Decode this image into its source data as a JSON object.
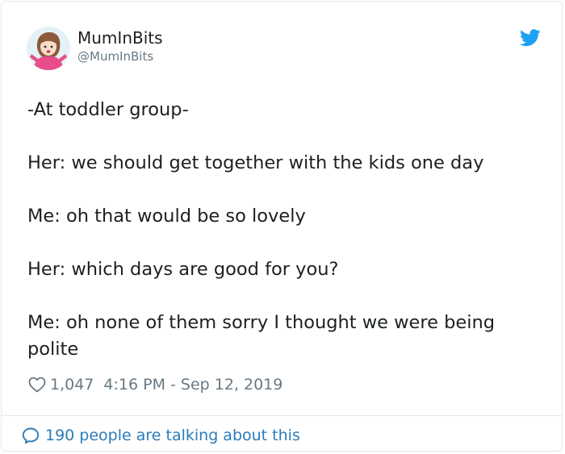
{
  "author": {
    "display_name": "MumInBits",
    "handle": "@MumInBits",
    "avatar_icon": "avatar-cartoon-woman"
  },
  "brand": {
    "icon": "twitter-bird-icon",
    "color": "#1da1f2"
  },
  "tweet": {
    "paragraphs": [
      "-At toddler group-",
      "Her: we should get together with the kids one day",
      "Me: oh that would be so lovely",
      "Her: which days are good for you?",
      "Me: oh none of them sorry I thought we were being polite"
    ]
  },
  "meta": {
    "likes": "1,047",
    "timestamp": "4:16 PM - Sep 12, 2019",
    "heart_icon": "heart-outline-icon"
  },
  "footer": {
    "talking_text": "190 people are talking about this",
    "bubble_icon": "speech-bubble-icon",
    "link_color": "#2b7bb9"
  }
}
